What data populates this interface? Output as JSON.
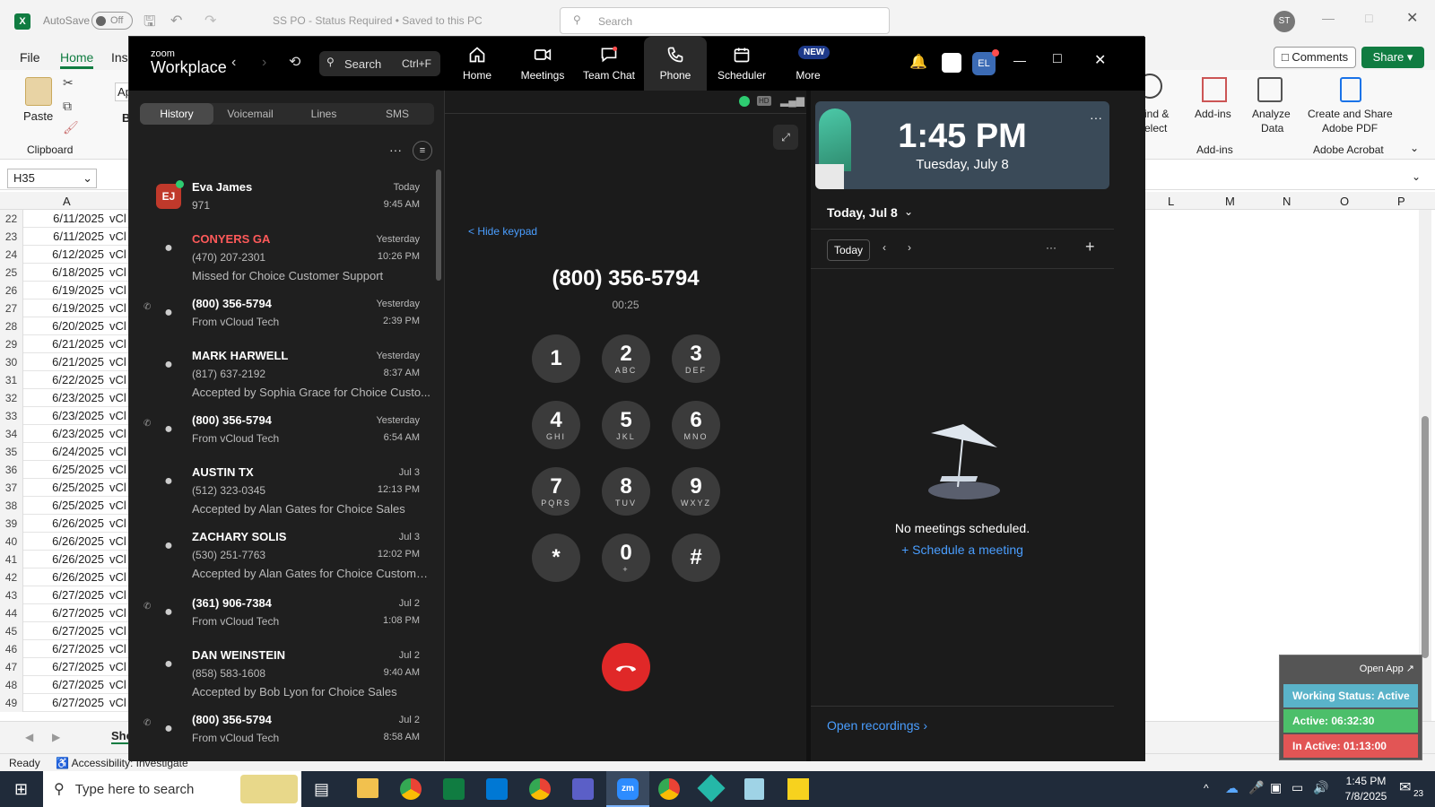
{
  "excel": {
    "autosave_label": "AutoSave",
    "autosave_state": "Off",
    "doc_title": "SS PO - Status Required • Saved to this PC",
    "search_placeholder": "Search",
    "user_initials": "ST",
    "menu": [
      "File",
      "Home",
      "Inse"
    ],
    "comments": "Comments",
    "share": "Share",
    "ribbon": {
      "paste": "Paste",
      "clipboard": "Clipboard",
      "find": "ind &",
      "select": "elect",
      "addins": "Add-ins",
      "addins_group": "Add-ins",
      "analyze": "Analyze",
      "analyze2": "Data",
      "create_pdf": "Create and Share",
      "create_pdf2": "Adobe PDF",
      "acrobat": "Adobe Acrobat",
      "ap": "Ap",
      "b": "B"
    },
    "namebox": "H35",
    "col_a": "A",
    "cols_right": [
      "L",
      "M",
      "N",
      "O",
      "P"
    ],
    "rows": [
      {
        "n": "22",
        "d": "6/11/2025",
        "v": "vCl"
      },
      {
        "n": "23",
        "d": "6/11/2025",
        "v": "vCl"
      },
      {
        "n": "24",
        "d": "6/12/2025",
        "v": "vCl"
      },
      {
        "n": "25",
        "d": "6/18/2025",
        "v": "vCl"
      },
      {
        "n": "26",
        "d": "6/19/2025",
        "v": "vCl"
      },
      {
        "n": "27",
        "d": "6/19/2025",
        "v": "vCl"
      },
      {
        "n": "28",
        "d": "6/20/2025",
        "v": "vCl"
      },
      {
        "n": "29",
        "d": "6/21/2025",
        "v": "vCl"
      },
      {
        "n": "30",
        "d": "6/21/2025",
        "v": "vCl"
      },
      {
        "n": "31",
        "d": "6/22/2025",
        "v": "vCl"
      },
      {
        "n": "32",
        "d": "6/23/2025",
        "v": "vCl"
      },
      {
        "n": "33",
        "d": "6/23/2025",
        "v": "vCl"
      },
      {
        "n": "34",
        "d": "6/23/2025",
        "v": "vCl"
      },
      {
        "n": "35",
        "d": "6/24/2025",
        "v": "vCl"
      },
      {
        "n": "36",
        "d": "6/25/2025",
        "v": "vCl"
      },
      {
        "n": "37",
        "d": "6/25/2025",
        "v": "vCl"
      },
      {
        "n": "38",
        "d": "6/25/2025",
        "v": "vCl"
      },
      {
        "n": "39",
        "d": "6/26/2025",
        "v": "vCl"
      },
      {
        "n": "40",
        "d": "6/26/2025",
        "v": "vCl"
      },
      {
        "n": "41",
        "d": "6/26/2025",
        "v": "vCl"
      },
      {
        "n": "42",
        "d": "6/26/2025",
        "v": "vCl"
      },
      {
        "n": "43",
        "d": "6/27/2025",
        "v": "vCl"
      },
      {
        "n": "44",
        "d": "6/27/2025",
        "v": "vCl"
      },
      {
        "n": "45",
        "d": "6/27/2025",
        "v": "vCl"
      },
      {
        "n": "46",
        "d": "6/27/2025",
        "v": "vCl"
      },
      {
        "n": "47",
        "d": "6/27/2025",
        "v": "vCl"
      },
      {
        "n": "48",
        "d": "6/27/2025",
        "v": "vCl"
      },
      {
        "n": "49",
        "d": "6/27/2025",
        "v": "vCl"
      }
    ],
    "sheet_tab": "She",
    "status_ready": "Ready",
    "accessibility": "Accessibility: Investigate"
  },
  "zoom": {
    "brand_top": "zoom",
    "brand": "Workplace",
    "search": "Search",
    "search_shortcut": "Ctrl+F",
    "nav": [
      {
        "label": "Home"
      },
      {
        "label": "Meetings"
      },
      {
        "label": "Team Chat"
      },
      {
        "label": "Phone"
      },
      {
        "label": "Scheduler"
      },
      {
        "label": "More"
      }
    ],
    "new_badge": "NEW",
    "avatar": "EL",
    "tabs": [
      "History",
      "Voicemail",
      "Lines",
      "SMS"
    ],
    "history": [
      {
        "name": "Eva James",
        "l2": "971",
        "l3": "",
        "date": "Today",
        "time": "9:45 AM",
        "initials": "EJ"
      },
      {
        "name": "CONYERS GA",
        "l2": "(470) 207-2301",
        "l3": "Missed for Choice Customer Support",
        "date": "Yesterday",
        "time": "10:26 PM"
      },
      {
        "name": "(800) 356-5794",
        "l2": "From vCloud Tech",
        "l3": "",
        "date": "Yesterday",
        "time": "2:39 PM"
      },
      {
        "name": "MARK HARWELL",
        "l2": "(817) 637-2192",
        "l3": "Accepted by Sophia Grace for Choice Custo...",
        "date": "Yesterday",
        "time": "8:37 AM"
      },
      {
        "name": "(800) 356-5794",
        "l2": "From vCloud Tech",
        "l3": "",
        "date": "Yesterday",
        "time": "6:54 AM"
      },
      {
        "name": "AUSTIN TX",
        "l2": "(512) 323-0345",
        "l3": "Accepted by Alan Gates for Choice Sales",
        "date": "Jul 3",
        "time": "12:13 PM"
      },
      {
        "name": "ZACHARY SOLIS",
        "l2": "(530) 251-7763",
        "l3": "Accepted by Alan Gates for Choice Customer...",
        "date": "Jul 3",
        "time": "12:02 PM"
      },
      {
        "name": "(361) 906-7384",
        "l2": "From vCloud Tech",
        "l3": "",
        "date": "Jul 2",
        "time": "1:08 PM"
      },
      {
        "name": "DAN WEINSTEIN",
        "l2": "(858) 583-1608",
        "l3": "Accepted by Bob Lyon for Choice Sales",
        "date": "Jul 2",
        "time": "9:40 AM"
      },
      {
        "name": "(800) 356-5794",
        "l2": "From vCloud Tech",
        "l3": "",
        "date": "Jul 2",
        "time": "8:58 AM"
      }
    ],
    "hd": "HD",
    "hide_keypad": "< Hide keypad",
    "call_number": "(800) 356-5794",
    "call_timer": "00:25",
    "keys": [
      {
        "n": "1",
        "s": ""
      },
      {
        "n": "2",
        "s": "ABC"
      },
      {
        "n": "3",
        "s": "DEF"
      },
      {
        "n": "4",
        "s": "GHI"
      },
      {
        "n": "5",
        "s": "JKL"
      },
      {
        "n": "6",
        "s": "MNO"
      },
      {
        "n": "7",
        "s": "PQRS"
      },
      {
        "n": "8",
        "s": "TUV"
      },
      {
        "n": "9",
        "s": "WXYZ"
      },
      {
        "n": "*",
        "s": ""
      },
      {
        "n": "0",
        "s": "+"
      },
      {
        "n": "#",
        "s": ""
      }
    ],
    "clock_time": "1:45 PM",
    "clock_date": "Tuesday, July 8",
    "today_header": "Today, Jul 8",
    "today_btn": "Today",
    "no_meetings": "No meetings scheduled.",
    "schedule": "Schedule a meeting",
    "open_recordings": "Open recordings"
  },
  "widget": {
    "open_app": "Open App ↗",
    "working": "Working Status: Active",
    "active": "Active: 06:32:30",
    "inactive": "In Active: 01:13:00"
  },
  "taskbar": {
    "search": "Type here to search",
    "time": "1:45 PM",
    "date": "7/8/2025",
    "notif": "23"
  }
}
